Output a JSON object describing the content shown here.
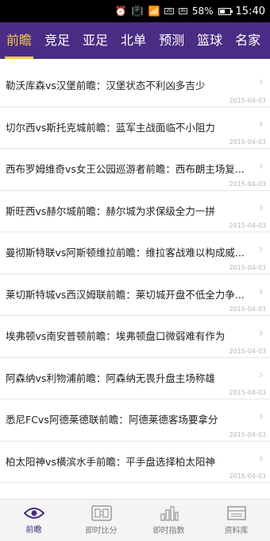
{
  "status_bar": {
    "battery": "58%",
    "battery_level": 0.58,
    "time": "15:40",
    "sim_labels": [
      "2G",
      "3G"
    ]
  },
  "tabs": [
    {
      "label": "前瞻",
      "active": true
    },
    {
      "label": "竞足",
      "active": false
    },
    {
      "label": "亚足",
      "active": false
    },
    {
      "label": "北单",
      "active": false
    },
    {
      "label": "预测",
      "active": false
    },
    {
      "label": "篮球",
      "active": false
    },
    {
      "label": "名家",
      "active": false
    }
  ],
  "articles": [
    {
      "title": "勒沃库森vs汉堡前瞻：汉堡状态不利凶多吉少",
      "date": "2015-04-03"
    },
    {
      "title": "切尔西vs斯托克城前瞻：蓝军主战面临不小阻力",
      "date": "2015-04-03"
    },
    {
      "title": "西布罗姆维奇vs女王公园巡游者前瞻：西布朗主场复...",
      "date": "2015-04-03"
    },
    {
      "title": "斯旺西vs赫尔城前瞻：赫尔城为求保级全力一拼",
      "date": "2015-04-03"
    },
    {
      "title": "曼彻斯特联vs阿斯顿维拉前瞻：维拉客战难以构成威...",
      "date": "2015-04-03"
    },
    {
      "title": "莱切斯特城vs西汉姆联前瞻：莱切城开盘不低全力争...",
      "date": "2015-04-03"
    },
    {
      "title": "埃弗顿vs南安普顿前瞻：埃弗顿盘口微弱难有作为",
      "date": "2015-04-03"
    },
    {
      "title": "阿森纳vs利物浦前瞻：阿森纳无畏升盘主场称雄",
      "date": "2015-04-03"
    },
    {
      "title": "悉尼FCvs阿德莱德联前瞻：阿德莱德客场要拿分",
      "date": "2015-04-03"
    },
    {
      "title": "柏太阳神vs横滨水手前瞻：平手盘选择柏太阳神",
      "date": "2015-04-03"
    }
  ],
  "bottom_nav": [
    {
      "label": "前瞻",
      "icon": "eye-icon",
      "active": true
    },
    {
      "label": "即时比分",
      "icon": "scoreboard-icon",
      "active": false
    },
    {
      "label": "即时指数",
      "icon": "bar-chart-icon",
      "active": false
    },
    {
      "label": "资料库",
      "icon": "database-icon",
      "active": false
    }
  ],
  "colors": {
    "header": "#4a2c84",
    "active_tab": "#f3c94b",
    "date_text": "#b5b5b5"
  }
}
